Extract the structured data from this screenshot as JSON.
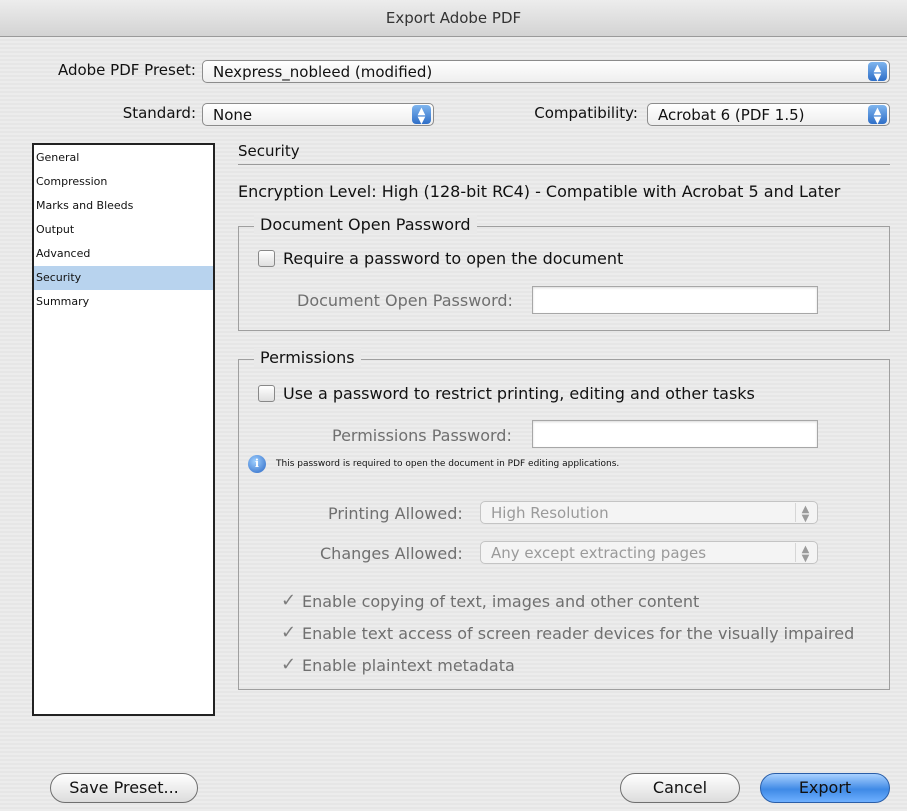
{
  "window": {
    "title": "Export Adobe PDF"
  },
  "header": {
    "preset_label": "Adobe PDF Preset:",
    "preset_value": "Nexpress_nobleed (modified)",
    "standard_label": "Standard:",
    "standard_value": "None",
    "compat_label": "Compatibility:",
    "compat_value": "Acrobat 6 (PDF 1.5)"
  },
  "sidebar": {
    "items": [
      {
        "label": "General"
      },
      {
        "label": "Compression"
      },
      {
        "label": "Marks and Bleeds"
      },
      {
        "label": "Output"
      },
      {
        "label": "Advanced"
      },
      {
        "label": "Security"
      },
      {
        "label": "Summary"
      }
    ],
    "selected": "Security"
  },
  "security": {
    "title": "Security",
    "encryption": "Encryption Level: High (128-bit RC4) - Compatible with Acrobat 5 and Later",
    "open_group": {
      "title": "Document Open Password",
      "checkbox_label": "Require a password to open the document",
      "checked": false,
      "password_label": "Document Open Password:",
      "password_value": ""
    },
    "permissions": {
      "title": "Permissions",
      "checkbox_label": "Use a password to restrict printing, editing and other tasks",
      "checked": false,
      "password_label": "Permissions Password:",
      "password_value": "",
      "note": "This password is required to open the document in PDF editing applications.",
      "printing_label": "Printing Allowed:",
      "printing_value": "High Resolution",
      "changes_label": "Changes Allowed:",
      "changes_value": "Any except extracting pages",
      "options": [
        {
          "label": "Enable copying of text, images and other content",
          "checked": true
        },
        {
          "label": "Enable text access of screen reader devices for the visually impaired",
          "checked": true
        },
        {
          "label": "Enable plaintext metadata",
          "checked": true
        }
      ]
    }
  },
  "footer": {
    "save_preset": "Save Preset...",
    "cancel": "Cancel",
    "export": "Export"
  },
  "icons": {
    "info": "i",
    "check": "✓",
    "popup_arrows": "▲▼"
  },
  "colors": {
    "accent": "#3f8ae6",
    "selection": "#b8d3ee"
  }
}
